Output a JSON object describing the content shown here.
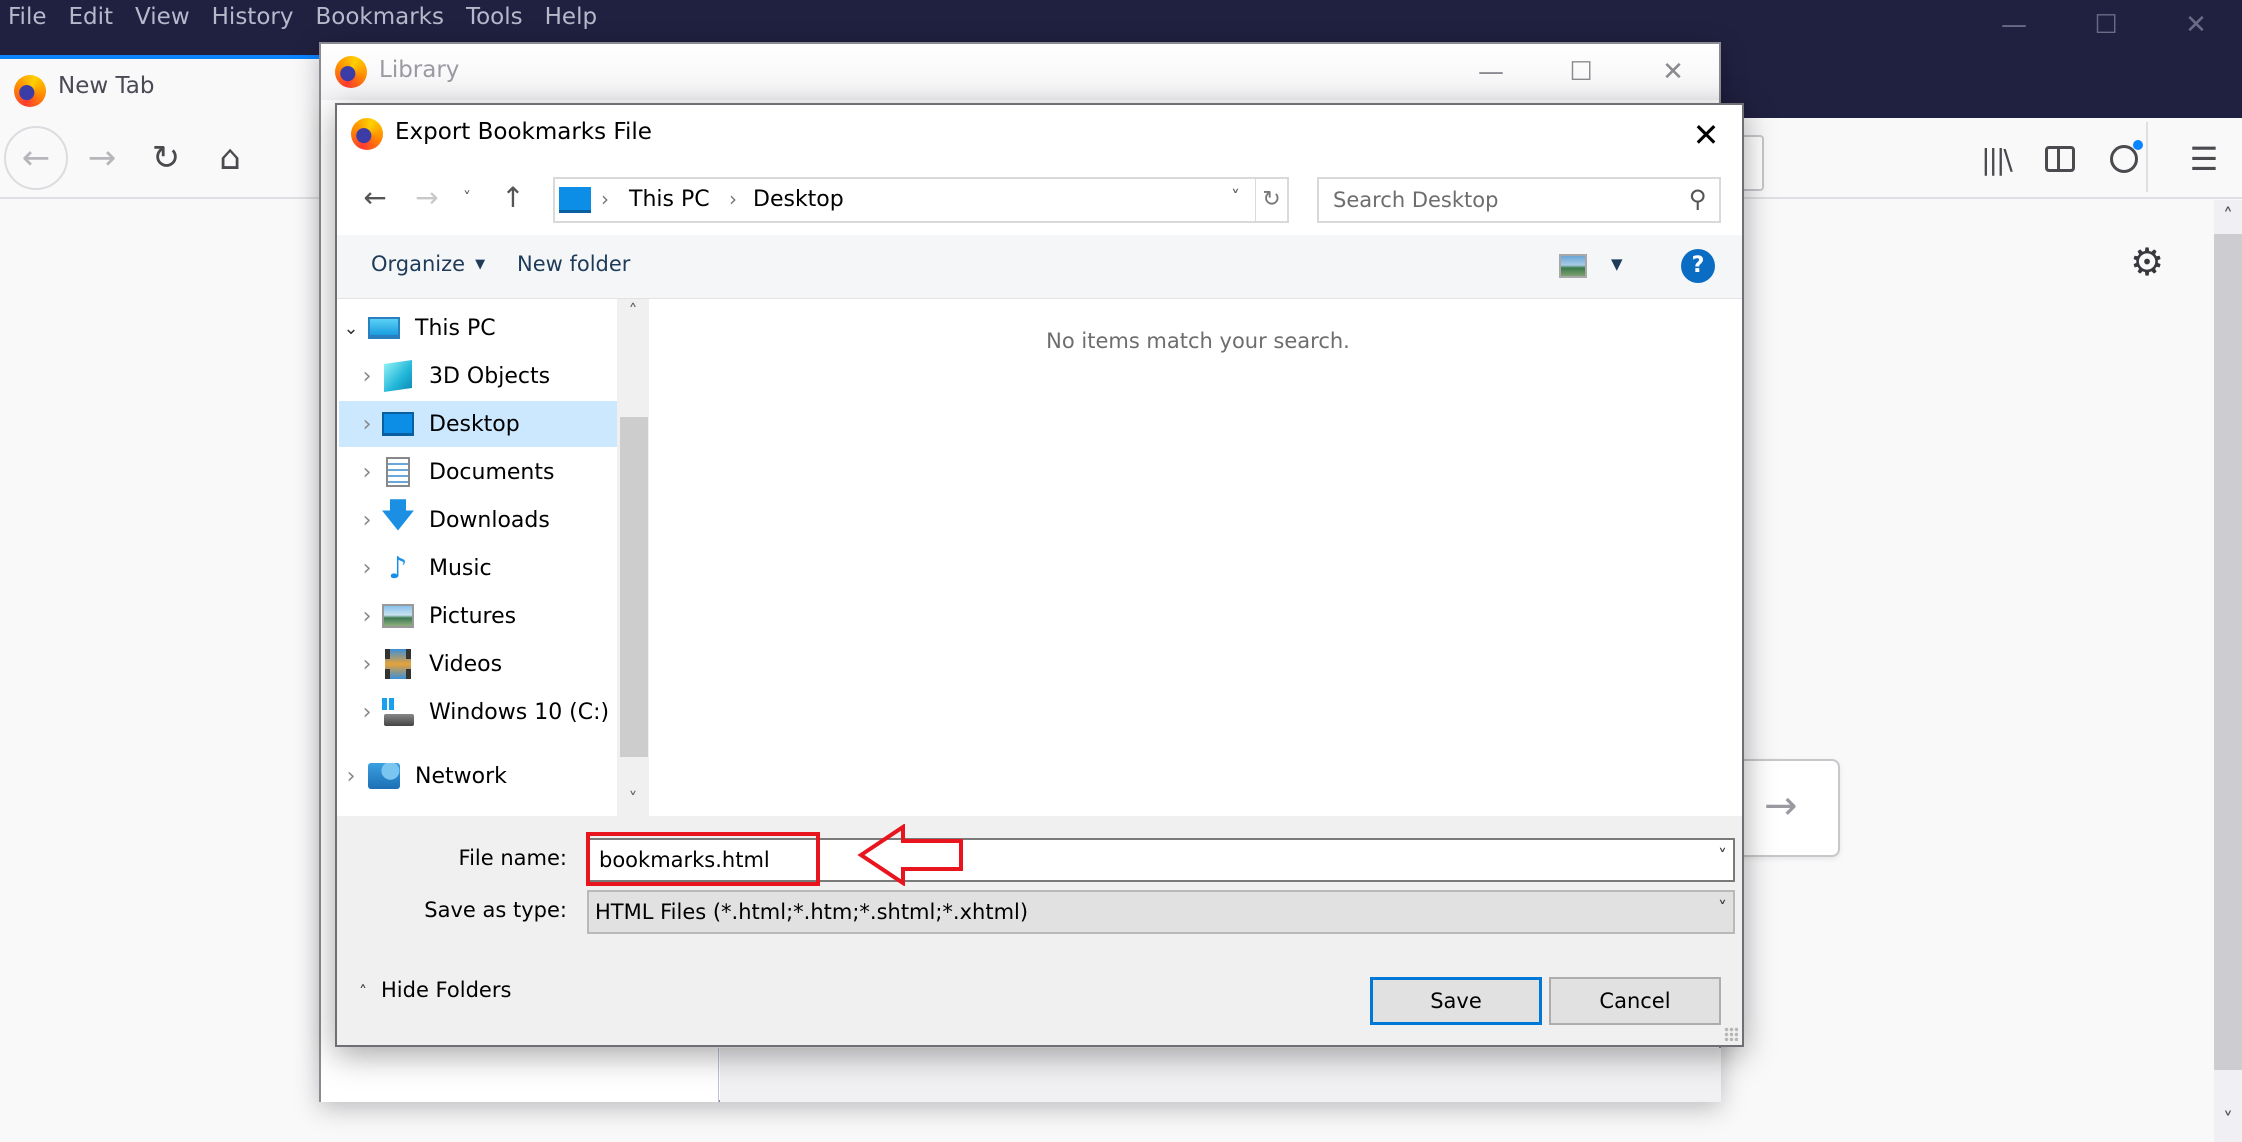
{
  "browser": {
    "menus": [
      {
        "label": "File",
        "accel": "F"
      },
      {
        "label": "Edit",
        "accel": "E"
      },
      {
        "label": "View",
        "accel": "V"
      },
      {
        "label": "History",
        "accel": "s"
      },
      {
        "label": "Bookmarks",
        "accel": "B"
      },
      {
        "label": "Tools",
        "accel": "T"
      },
      {
        "label": "Help",
        "accel": "H"
      }
    ],
    "window_controls": {
      "minimize": "—",
      "maximize": "☐",
      "close": "✕"
    },
    "tab": {
      "title": "New Tab",
      "icon": "firefox-icon"
    },
    "nav": {
      "back": "←",
      "forward": "→",
      "reload": "↻",
      "home": "⌂"
    },
    "toolbar_icons": {
      "library": "|||\\",
      "sidebar": "▯",
      "account": "◉",
      "menu": "☰"
    },
    "page": {
      "settings_icon": "⚙",
      "go_arrow": "→"
    },
    "scroll": {
      "up": "˄",
      "down": "˅"
    }
  },
  "library": {
    "title": "Library",
    "controls": {
      "minimize": "—",
      "maximize": "☐",
      "close": "✕"
    }
  },
  "dialog": {
    "title": "Export Bookmarks File",
    "close": "✕",
    "address": {
      "back": "←",
      "forward": "→",
      "recent": "˅",
      "up": "↑",
      "crumbs": [
        "This PC",
        "Desktop"
      ],
      "separator": "›",
      "dropdown": "˅",
      "refresh": "↻"
    },
    "search": {
      "placeholder": "Search Desktop",
      "value": "",
      "icon": "⚲"
    },
    "commands": {
      "organize": "Organize",
      "organize_caret": "▼",
      "new_folder": "New folder",
      "view_caret": "▼",
      "help": "?"
    },
    "tree": [
      {
        "label": "This PC",
        "icon": "this-pc-icon",
        "expanded": true,
        "level": 0
      },
      {
        "label": "3D Objects",
        "icon": "3d-objects-icon",
        "level": 1
      },
      {
        "label": "Desktop",
        "icon": "desktop-icon",
        "level": 1,
        "selected": true
      },
      {
        "label": "Documents",
        "icon": "documents-icon",
        "level": 1
      },
      {
        "label": "Downloads",
        "icon": "downloads-icon",
        "level": 1
      },
      {
        "label": "Music",
        "icon": "music-icon",
        "level": 1
      },
      {
        "label": "Pictures",
        "icon": "pictures-icon",
        "level": 1
      },
      {
        "label": "Videos",
        "icon": "videos-icon",
        "level": 1
      },
      {
        "label": "Windows 10 (C:)",
        "icon": "drive-icon",
        "level": 1
      },
      {
        "label": "Network",
        "icon": "network-icon",
        "level": 0
      }
    ],
    "tree_scroll": {
      "up": "˄",
      "down": "˅"
    },
    "empty_message": "No items match your search.",
    "file_name_label": "File name:",
    "file_name_value": "bookmarks.html",
    "save_type_label": "Save as type:",
    "save_type_value": "HTML Files (*.html;*.htm;*.shtml;*.xhtml)",
    "dropdown_chevron": "˅",
    "hide_folders": "Hide Folders",
    "hide_folders_icon": "˄",
    "save": "Save",
    "cancel": "Cancel"
  },
  "annotation": {
    "color": "#e8141e",
    "target": "file-name-field"
  },
  "colors": {
    "menubar": "#202040",
    "tab_accent": "#0a84ff",
    "selection": "#cce8ff",
    "default_button": "#0078d7",
    "help": "#0b6cc4"
  }
}
